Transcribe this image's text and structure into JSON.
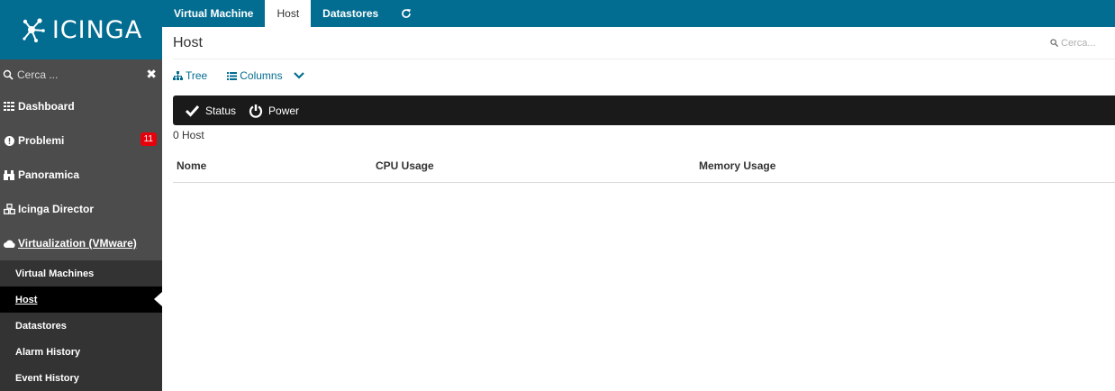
{
  "brand": {
    "logo_text": "ICINGA"
  },
  "colors": {
    "brand": "#036d91",
    "sidebar": "#333333",
    "badge": "#e5000b",
    "actionbar": "#1a1a1a"
  },
  "sidebar": {
    "search_placeholder": "Cerca ...",
    "items": [
      {
        "label": "Dashboard",
        "icon": "grid-icon"
      },
      {
        "label": "Problemi",
        "icon": "alert-icon",
        "badge": "11"
      },
      {
        "label": "Panoramica",
        "icon": "binoculars-icon"
      },
      {
        "label": "Icinga Director",
        "icon": "cubes-icon"
      },
      {
        "label": "Virtualization (VMware)",
        "icon": "cloud-icon"
      }
    ],
    "sub_items": [
      {
        "label": "Virtual Machines"
      },
      {
        "label": "Host"
      },
      {
        "label": "Datastores"
      },
      {
        "label": "Alarm History"
      },
      {
        "label": "Event History"
      }
    ]
  },
  "tabs": [
    {
      "label": "Virtual Machine"
    },
    {
      "label": "Host"
    },
    {
      "label": "Datastores"
    }
  ],
  "main": {
    "title": "Host",
    "search_placeholder": "Cerca...",
    "controls": {
      "tree_label": "Tree",
      "columns_label": "Columns"
    },
    "actions": {
      "status_label": "Status",
      "power_label": "Power"
    },
    "count_text": "0 Host",
    "columns": [
      "Nome",
      "CPU Usage",
      "Memory Usage"
    ]
  }
}
